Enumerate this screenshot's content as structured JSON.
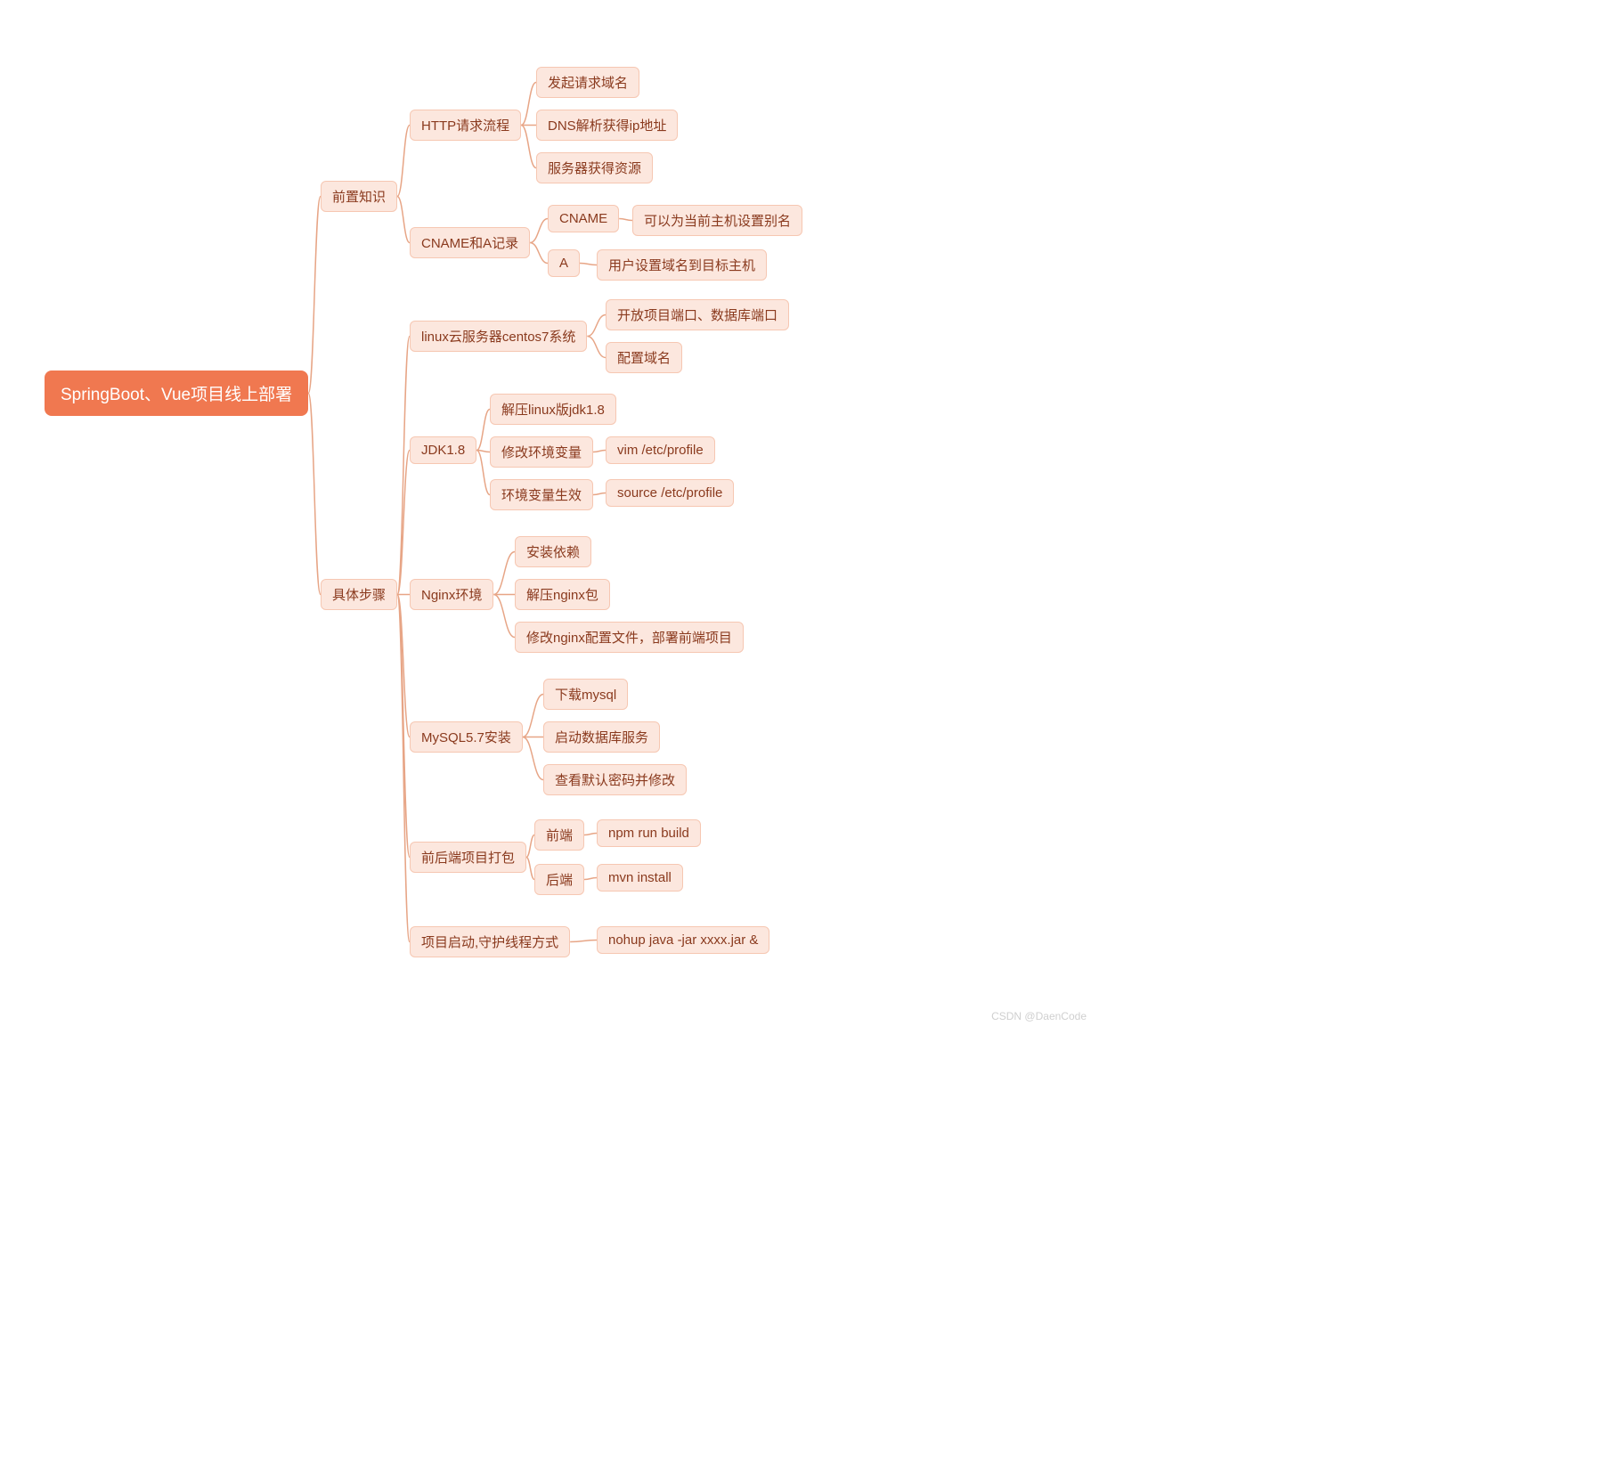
{
  "root": "SpringBoot、Vue项目线上部署",
  "level1": {
    "pre": "前置知识",
    "steps": "具体步骤"
  },
  "pre": {
    "http": "HTTP请求流程",
    "http_items": {
      "a": "发起请求域名",
      "b": "DNS解析获得ip地址",
      "c": "服务器获得资源"
    },
    "cname": "CNAME和A记录",
    "cname_items": {
      "cname_lbl": "CNAME",
      "cname_desc": "可以为当前主机设置别名",
      "a_lbl": "A",
      "a_desc": "用户设置域名到目标主机"
    }
  },
  "steps": {
    "linux": "linux云服务器centos7系统",
    "linux_items": {
      "a": "开放项目端口、数据库端口",
      "b": "配置域名"
    },
    "jdk": "JDK1.8",
    "jdk_items": {
      "a": "解压linux版jdk1.8",
      "b": "修改环境变量",
      "b_cmd": "vim /etc/profile",
      "c": "环境变量生效",
      "c_cmd": "source /etc/profile"
    },
    "nginx": "Nginx环境",
    "nginx_items": {
      "a": "安装依赖",
      "b": "解压nginx包",
      "c": "修改nginx配置文件，部署前端项目"
    },
    "mysql": "MySQL5.7安装",
    "mysql_items": {
      "a": "下载mysql",
      "b": "启动数据库服务",
      "c": "查看默认密码并修改"
    },
    "pack": "前后端项目打包",
    "pack_items": {
      "fe_lbl": "前端",
      "fe_cmd": "npm run build",
      "be_lbl": "后端",
      "be_cmd": "mvn install"
    },
    "launch": "项目启动,守护线程方式",
    "launch_cmd": "nohup java -jar xxxx.jar &"
  },
  "watermark": "CSDN @DaenCode"
}
